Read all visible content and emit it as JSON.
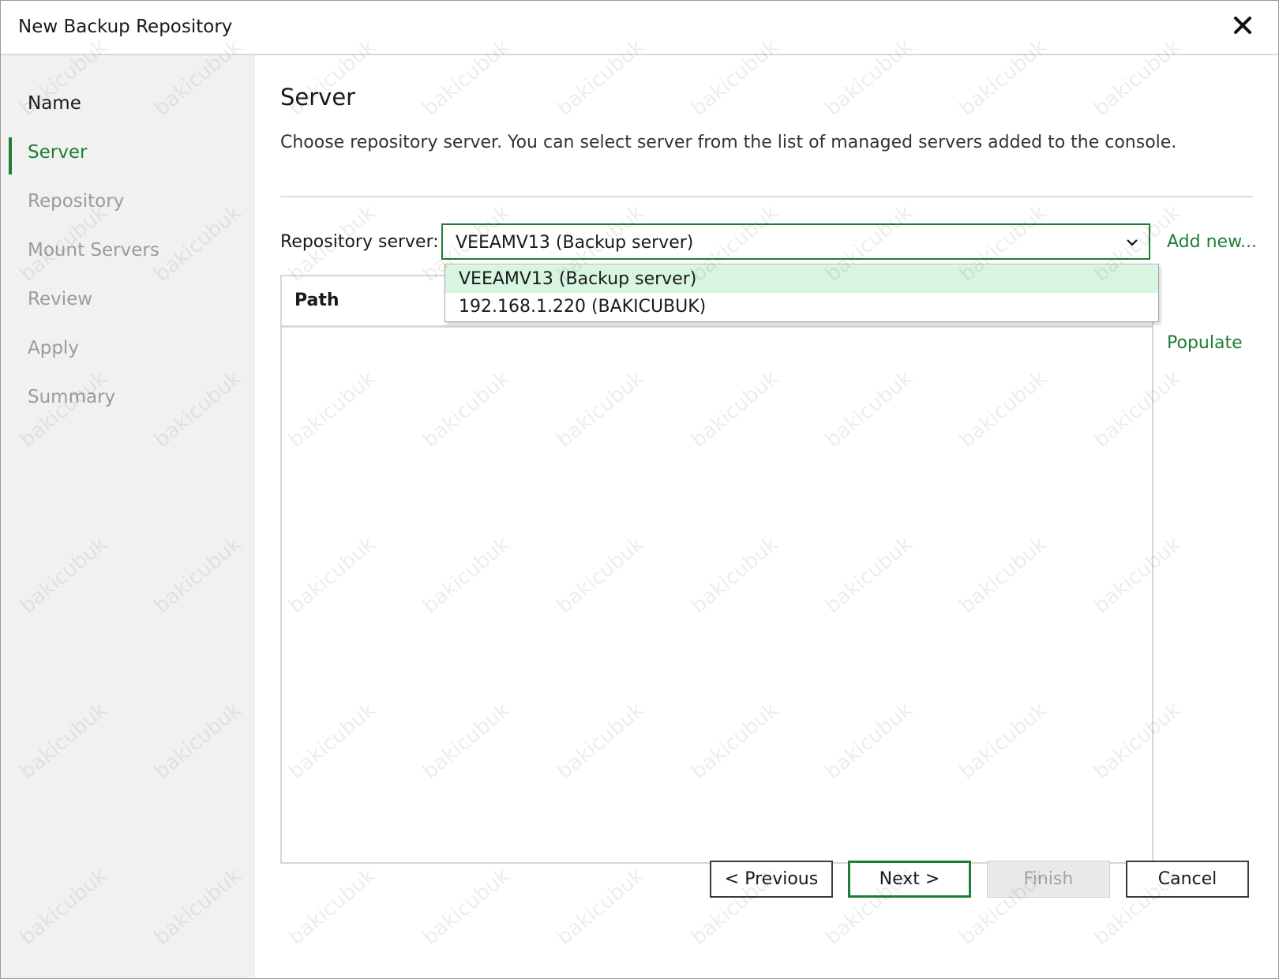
{
  "window": {
    "title": "New Backup Repository",
    "close_icon": "close-icon"
  },
  "sidebar": {
    "steps": [
      {
        "label": "Name",
        "state": "done"
      },
      {
        "label": "Server",
        "state": "active"
      },
      {
        "label": "Repository",
        "state": "pending"
      },
      {
        "label": "Mount Servers",
        "state": "pending"
      },
      {
        "label": "Review",
        "state": "pending"
      },
      {
        "label": "Apply",
        "state": "pending"
      },
      {
        "label": "Summary",
        "state": "pending"
      }
    ]
  },
  "main": {
    "title": "Server",
    "description": "Choose repository server. You can select server from the list of managed servers added to the console.",
    "repo_server_label": "Repository server:",
    "repo_server_value": "VEEAMV13 (Backup server)",
    "add_new_label": "Add new...",
    "populate_label": "Populate",
    "table": {
      "columns": [
        "Path"
      ]
    },
    "dropdown_options": [
      {
        "label": "VEEAMV13 (Backup server)",
        "selected": true
      },
      {
        "label": "192.168.1.220 (BAKICUBUK)",
        "selected": false
      }
    ]
  },
  "footer": {
    "previous_label": "< Previous",
    "next_label": "Next >",
    "finish_label": "Finish",
    "cancel_label": "Cancel"
  },
  "watermark": "bakicubuk",
  "colors": {
    "accent": "#1e7e34",
    "selected_option_bg": "#d8f5e1",
    "sidebar_bg": "#f1f1f1"
  }
}
